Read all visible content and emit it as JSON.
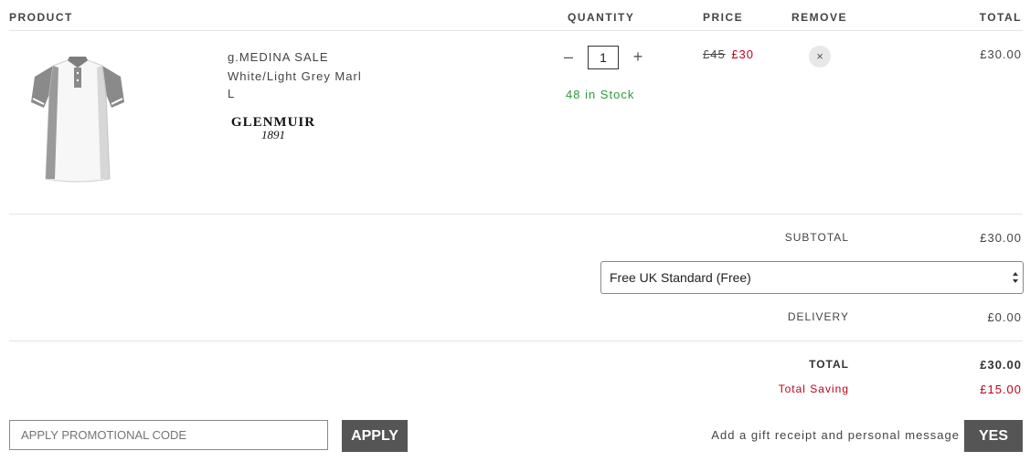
{
  "headers": {
    "product": "PRODUCT",
    "quantity": "QUANTITY",
    "price": "PRICE",
    "remove": "REMOVE",
    "total": "TOTAL"
  },
  "item": {
    "name": "g.MEDINA SALE",
    "colour": "White/Light Grey Marl",
    "size": "L",
    "brand": "GLENMUIR",
    "brand_year": "1891",
    "quantity": "1",
    "minus": "–",
    "plus": "+",
    "stock": "48 in Stock",
    "price_old": "£45",
    "price_new": "£30",
    "remove_icon": "×",
    "line_total": "£30.00"
  },
  "summary": {
    "subtotal_label": "SUBTOTAL",
    "subtotal_value": "£30.00",
    "delivery_option": "Free UK Standard (Free)",
    "delivery_label": "DELIVERY",
    "delivery_value": "£0.00",
    "total_label": "TOTAL",
    "total_value": "£30.00",
    "saving_label": "Total Saving",
    "saving_value": "£15.00"
  },
  "promo": {
    "placeholder": "APPLY PROMOTIONAL CODE",
    "apply_label": "APPLY"
  },
  "gift": {
    "text": "Add a gift receipt and personal message",
    "yes_label": "YES"
  },
  "colors": {
    "sale_red": "#c0001a",
    "stock_green": "#2a9d3a",
    "button_grey": "#555555"
  }
}
